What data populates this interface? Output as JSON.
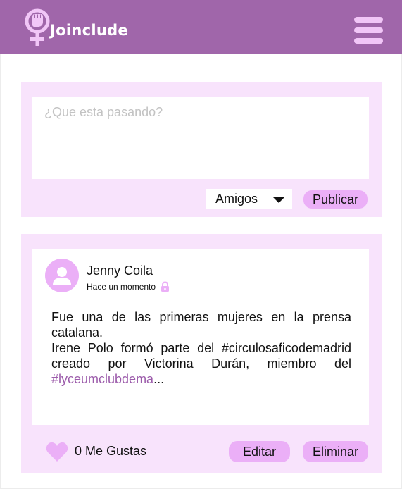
{
  "header": {
    "brand": "Joinclude",
    "logo_icon": "female-symbol-fist-icon",
    "menu_icon": "hamburger-menu-icon",
    "colors": {
      "bar": "#a066aa",
      "accent": "#f1c6f7"
    }
  },
  "composer": {
    "placeholder": "¿Que esta pasando?",
    "audience_selected": "Amigos",
    "audience_caret_icon": "caret-down-icon",
    "publish_label": "Publicar"
  },
  "post": {
    "author": "Jenny Coila",
    "timestamp": "Hace un momento",
    "privacy_icon": "lock-icon",
    "avatar_icon": "user-avatar-icon",
    "paragraph1": "Fue una de las primeras mujeres en la prensa catalana.",
    "paragraph2": "Irene Polo formó parte del #circulosaficodemadrid creado por Victorina Durán, miembro del",
    "link_text": "#lyceumclubdema",
    "ellipsis": "...",
    "like_icon": "heart-icon",
    "likes_label": "0 Me Gustas",
    "edit_label": "Editar",
    "delete_label": "Eliminar"
  },
  "colors": {
    "panel": "#f8e3fc",
    "button": "#ebaff7",
    "hashtag": "#9c5cab"
  }
}
